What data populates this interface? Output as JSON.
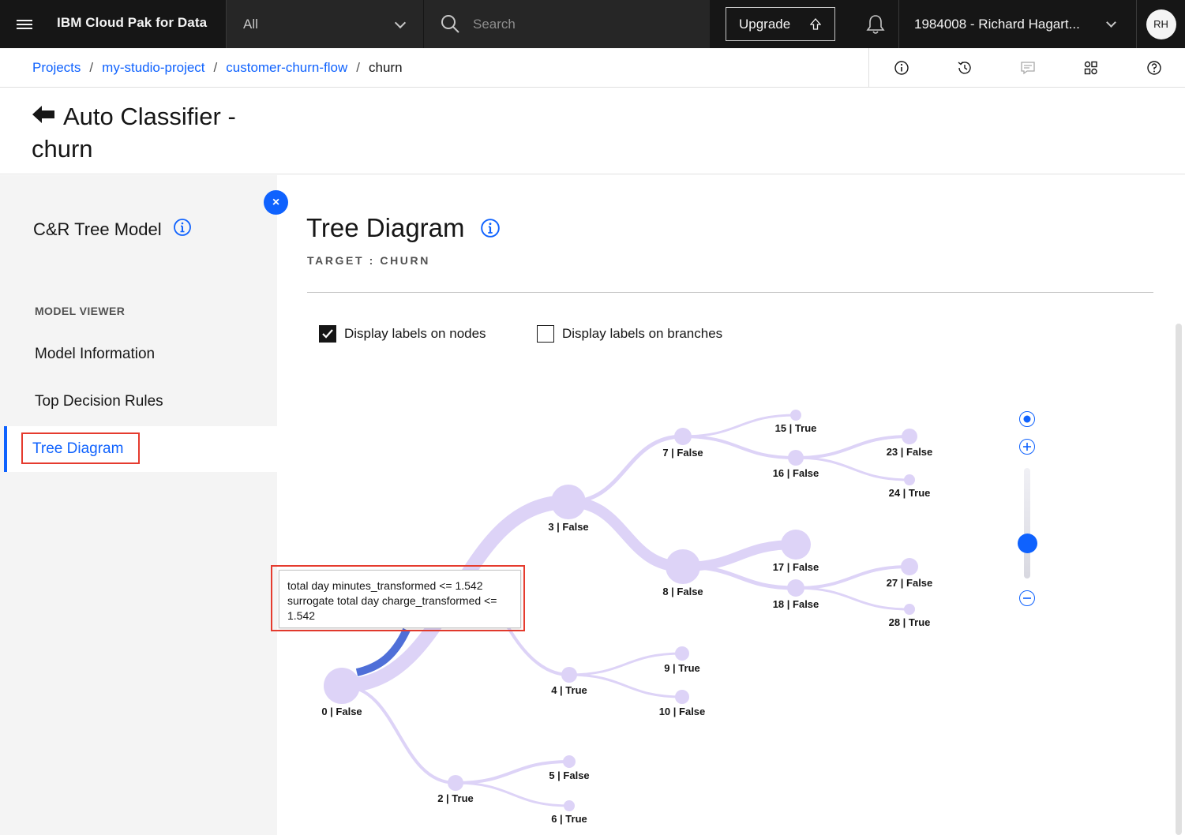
{
  "topbar": {
    "brand": "IBM Cloud Pak for Data",
    "scope": "All",
    "search_placeholder": "Search",
    "upgrade": "Upgrade",
    "account": "1984008 - Richard Hagart...",
    "avatar": "RH"
  },
  "breadcrumb": {
    "items": [
      "Projects",
      "my-studio-project",
      "customer-churn-flow"
    ],
    "current": "churn",
    "separator": "/"
  },
  "page": {
    "title": "Auto Classifier - churn"
  },
  "sidebar": {
    "model": "C&R Tree Model",
    "section": "MODEL VIEWER",
    "items": [
      "Model Information",
      "Top Decision Rules",
      "Tree Diagram"
    ],
    "active": "Tree Diagram"
  },
  "main": {
    "title": "Tree Diagram",
    "target": "TARGET : CHURN",
    "checkbox_nodes": "Display labels on nodes",
    "checkbox_nodes_checked": true,
    "checkbox_branches": "Display labels on branches",
    "checkbox_branches_checked": false
  },
  "tree": {
    "nodes": [
      {
        "id": 0,
        "label": "0 | False"
      },
      {
        "id": 2,
        "label": "2 | True"
      },
      {
        "id": 3,
        "label": "3 | False"
      },
      {
        "id": 4,
        "label": "4 | True"
      },
      {
        "id": 5,
        "label": "5 | False"
      },
      {
        "id": 6,
        "label": "6 | True"
      },
      {
        "id": 7,
        "label": "7 | False"
      },
      {
        "id": 8,
        "label": "8 | False"
      },
      {
        "id": 9,
        "label": "9 | True"
      },
      {
        "id": 10,
        "label": "10 | False"
      },
      {
        "id": 15,
        "label": "15 | True"
      },
      {
        "id": 16,
        "label": "16 | False"
      },
      {
        "id": 17,
        "label": "17 | False"
      },
      {
        "id": 18,
        "label": "18 | False"
      },
      {
        "id": 23,
        "label": "23 | False"
      },
      {
        "id": 24,
        "label": "24 | True"
      },
      {
        "id": 27,
        "label": "27 | False"
      },
      {
        "id": 28,
        "label": "28 | True"
      }
    ],
    "tooltip": {
      "line1": "total day minutes_transformed <= 1.542",
      "line2": "surrogate total day charge_transformed <=",
      "line3": "1.542"
    }
  },
  "colors": {
    "accent": "#0f62fe",
    "node": "#ddd3f7",
    "highlight": "#e53b2e"
  }
}
